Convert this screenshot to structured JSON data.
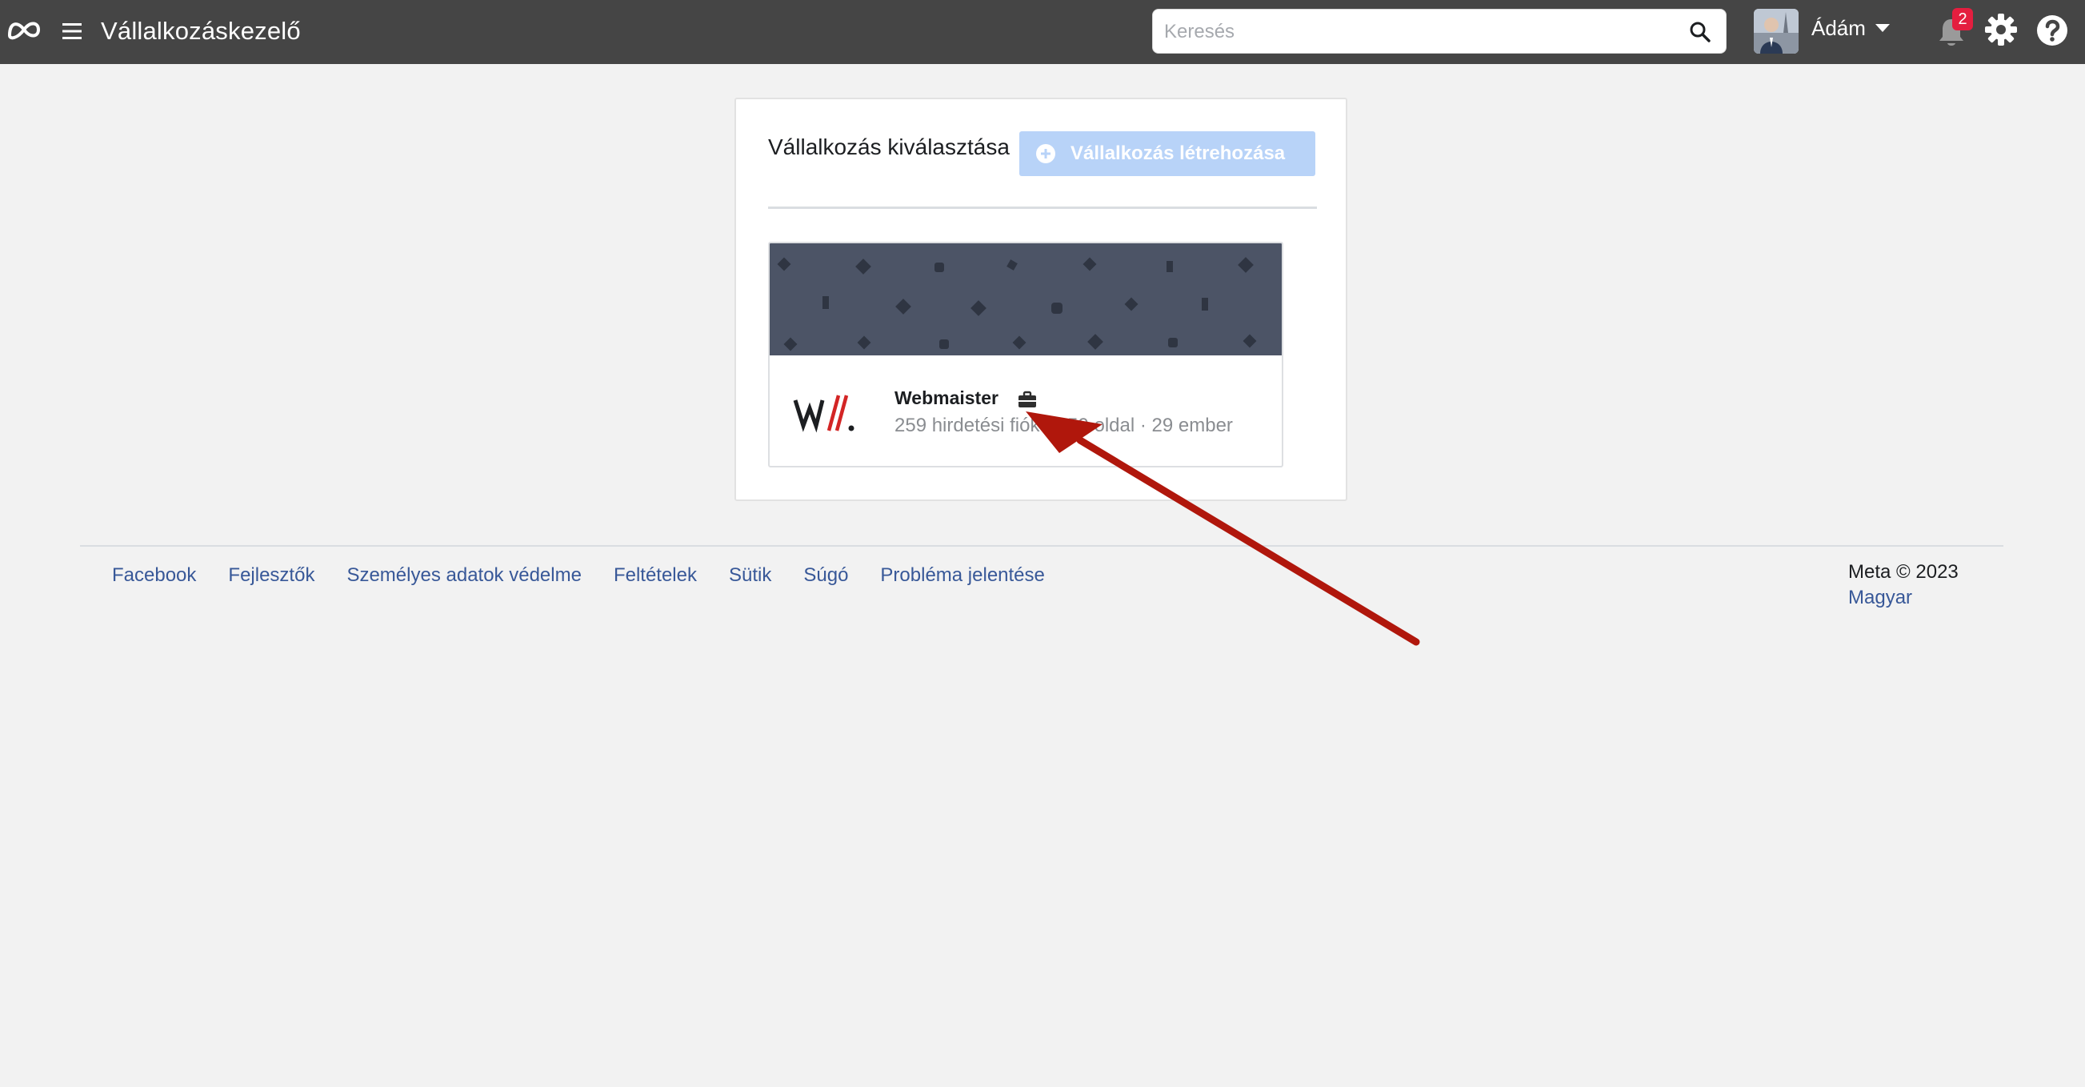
{
  "header": {
    "app_title": "Vállalkozáskezelő",
    "search_placeholder": "Keresés",
    "user_name": "Ádám",
    "notification_count": "2",
    "icons": [
      "meta-logo-icon",
      "menu-icon",
      "search-icon",
      "avatar",
      "chevron-down-icon",
      "bell-icon",
      "gear-icon",
      "help-icon"
    ]
  },
  "panel": {
    "title": "Vállalkozás kiválasztása",
    "create_button_label": "Vállalkozás létrehozása",
    "business": {
      "name": "Webmaister",
      "stats": "259 hirdetési fiók · 259 oldal · 29 ember"
    }
  },
  "footer": {
    "links": [
      "Facebook",
      "Fejlesztők",
      "Személyes adatok védelme",
      "Feltételek",
      "Sütik",
      "Súgó",
      "Probléma jelentése"
    ],
    "copyright": "Meta © 2023",
    "language": "Magyar"
  },
  "colors": {
    "topbar": "#454545",
    "create_button": "#b8d3f8",
    "banner": "#4c5466",
    "link": "#385898",
    "badge": "#e41e3f",
    "arrow": "#b0170c"
  }
}
